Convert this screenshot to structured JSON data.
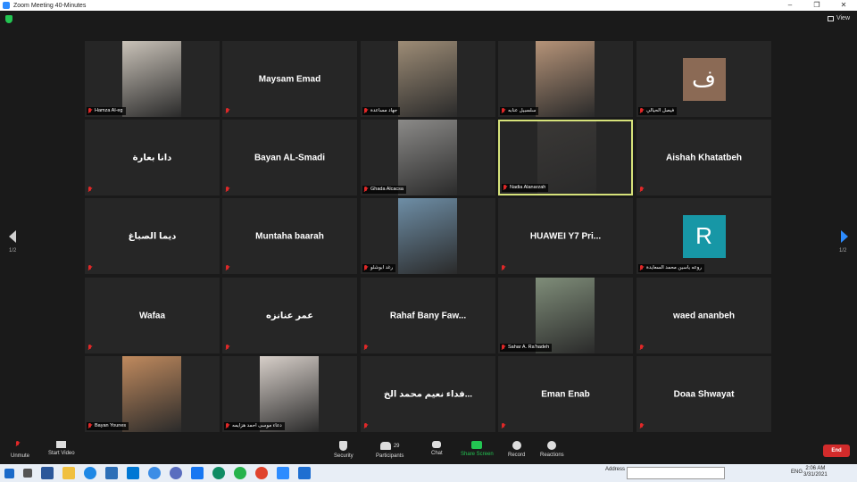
{
  "window": {
    "title": "Zoom Meeting 40-Minutes",
    "minimize": "–",
    "maximize": "❐",
    "close": "✕"
  },
  "topbar": {
    "view_label": "View"
  },
  "navigation": {
    "left_page": "1/2",
    "right_page": "1/2"
  },
  "tiles": [
    {
      "name": "Hamza Al-eg",
      "kind": "video",
      "bg": "#c9c2b8",
      "display": false
    },
    {
      "name": "Maysam Emad",
      "kind": "name",
      "display": true
    },
    {
      "name": "جهاد مساعدة",
      "kind": "video",
      "bg": "#9d8c76",
      "display": false
    },
    {
      "name": "سلسبيل عنابه",
      "kind": "video",
      "bg": "#b59378",
      "display": false
    },
    {
      "name": "فيصل الحيالي",
      "kind": "avatar",
      "avatar_letter": "ف",
      "avatar_color": "#8b6a55",
      "display": false
    },
    {
      "name": "دانا بعارة",
      "kind": "name",
      "display": true
    },
    {
      "name": "Bayan AL-Smadi",
      "kind": "name",
      "display": true
    },
    {
      "name": "Ghada Alcacsa",
      "kind": "video",
      "bg": "#8b8a88",
      "display": false
    },
    {
      "name": "Nadia Alanarzah",
      "kind": "video",
      "bg": "#3a3836",
      "display": false,
      "active": true
    },
    {
      "name": "Aishah Khatatbeh",
      "kind": "name",
      "display": true
    },
    {
      "name": "ديما الصباغ",
      "kind": "name",
      "display": true
    },
    {
      "name": "Muntaha  baarah",
      "kind": "name",
      "display": true
    },
    {
      "name": "رغد ابوشلو",
      "kind": "video",
      "bg": "#6e8ea6",
      "display": false
    },
    {
      "name": "HUAWEI Y7 Pri...",
      "kind": "name",
      "display": true
    },
    {
      "name": "روعه ياسين محمد السعايدة",
      "kind": "avatar",
      "avatar_letter": "R",
      "avatar_color": "#1797a6",
      "display": false
    },
    {
      "name": "Wafaa",
      "kind": "name",
      "display": true
    },
    {
      "name": "عمر عنانزه",
      "kind": "name",
      "display": true
    },
    {
      "name": "Rahaf Bany Faw...",
      "kind": "name",
      "display": true
    },
    {
      "name": "Sahar A. Ra’hadeh",
      "kind": "video",
      "bg": "#7f8d79",
      "display": false
    },
    {
      "name": "waed ananbeh",
      "kind": "name",
      "display": true
    },
    {
      "name": "Bayan Younes",
      "kind": "video",
      "bg": "#c08a5e",
      "display": false
    },
    {
      "name": "دعاء موسى احمد هزايمه",
      "kind": "video",
      "bg": "#d7cfc9",
      "display": false
    },
    {
      "name": "فداء نعيم محمد الخ...",
      "kind": "name",
      "display": true
    },
    {
      "name": "Eman Enab",
      "kind": "name",
      "display": true
    },
    {
      "name": "Doaa  Shwayat",
      "kind": "name",
      "display": true
    }
  ],
  "toolbar": {
    "unmute": "Unmute",
    "start_video": "Start Video",
    "security": "Security",
    "participants": "Participants",
    "participants_count": "29",
    "chat": "Chat",
    "share_screen": "Share Screen",
    "record": "Record",
    "reactions": "Reactions",
    "end": "End"
  },
  "taskbar": {
    "address_label": "Address",
    "lang": "ENG",
    "time": "2:06 AM",
    "date": "3/31/2021"
  }
}
